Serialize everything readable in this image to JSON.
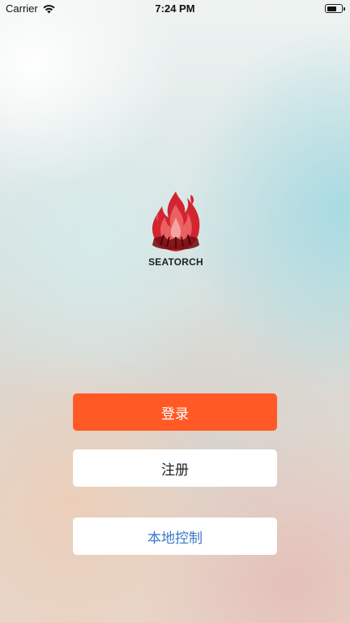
{
  "status_bar": {
    "carrier": "Carrier",
    "time": "7:24 PM",
    "wifi_icon": "wifi-icon",
    "battery_icon": "battery-icon",
    "battery_level": 0.7
  },
  "logo": {
    "icon": "flame-logo-icon",
    "text": "SEATORCH"
  },
  "buttons": {
    "login": "登录",
    "register": "注册",
    "local_control": "本地控制"
  },
  "colors": {
    "primary": "#ff5a26",
    "link": "#3b78c9",
    "flame": "#d3242f"
  }
}
